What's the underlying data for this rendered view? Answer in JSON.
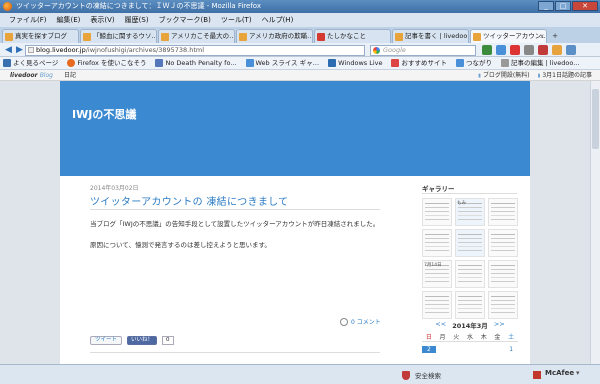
{
  "window": {
    "title": "ツイッターアカウントの凍結につきまして：ＩＷＪの不思議 - Mozilla Firefox",
    "min": "_",
    "max": "□",
    "close": "✕"
  },
  "menu": [
    "ファイル(F)",
    "編集(E)",
    "表示(V)",
    "履歴(S)",
    "ブックマーク(B)",
    "ツール(T)",
    "ヘルプ(H)"
  ],
  "tabs": [
    {
      "label": "真実を探すブログ"
    },
    {
      "label": "「鯨血に関するウソ…"
    },
    {
      "label": "アメリカこそ最大の…"
    },
    {
      "label": "アメリカ政府の欺瞞…"
    },
    {
      "label": "たしかなこと"
    },
    {
      "label": "記事を書く | livedoo…"
    },
    {
      "label": "ツイッターアカウン…"
    }
  ],
  "tab_close": "x",
  "tab_new": "+",
  "nav": {
    "back": "◀",
    "forward": "▶",
    "url_host": "blog.livedoor.jp",
    "url_path": "/iwjnofushigi/archives/3895738.html",
    "search_placeholder": "Google"
  },
  "bookmarks": [
    {
      "label": "よく見るページ",
      "color": "#3a6fb0"
    },
    {
      "label": "Firefox を使いこなそう",
      "color": "#e66b1f"
    },
    {
      "label": "No Death Penalty fo...",
      "color": "#5577bb"
    },
    {
      "label": "Web スライス ギャ…",
      "color": "#4a90d9"
    },
    {
      "label": "Windows Live",
      "color": "#2b6cb0"
    },
    {
      "label": "おすすめサイト",
      "color": "#d44"
    },
    {
      "label": "つながり",
      "color": "#4a90d9"
    },
    {
      "label": "記事の編集 | livedoo...",
      "color": "#999"
    }
  ],
  "livedoor_bar": {
    "logo": "livedoor",
    "logo_sub": "Blog",
    "diary": "日記",
    "right_links": [
      "ブログ開設(無料)",
      "3月1日話題の記事"
    ]
  },
  "blog": {
    "title": "IWJの不思議",
    "post_date": "2014年03月02日",
    "post_title": "ツイッターアカウントの 凍結につきまして",
    "paragraphs": [
      "当ブログ「IWJの不思議」の告知手段として設置したツイッターアカウントが昨日凍結されました。",
      "原因について、憶測で発言するのは差し控えようと思います。"
    ],
    "comment_count": "0 コメント",
    "tweet": "ツイート",
    "like": "いいね！",
    "like_count": "0"
  },
  "sidebar": {
    "gallery_title": "ギャラリー",
    "thumbs": [
      "",
      "もみ",
      "",
      "",
      "",
      "",
      "7月14日",
      "",
      "",
      "",
      "",
      ""
    ],
    "calendar": {
      "prev": "<<",
      "month": "2014年3月",
      "next": ">>",
      "weekdays": [
        "日",
        "月",
        "火",
        "水",
        "木",
        "金",
        "土"
      ],
      "first_row": [
        "",
        "",
        "",
        "",
        "",
        "",
        "1"
      ],
      "today": "2"
    }
  },
  "status": {
    "safe_search": "安全検索",
    "brand": "McAfee"
  }
}
